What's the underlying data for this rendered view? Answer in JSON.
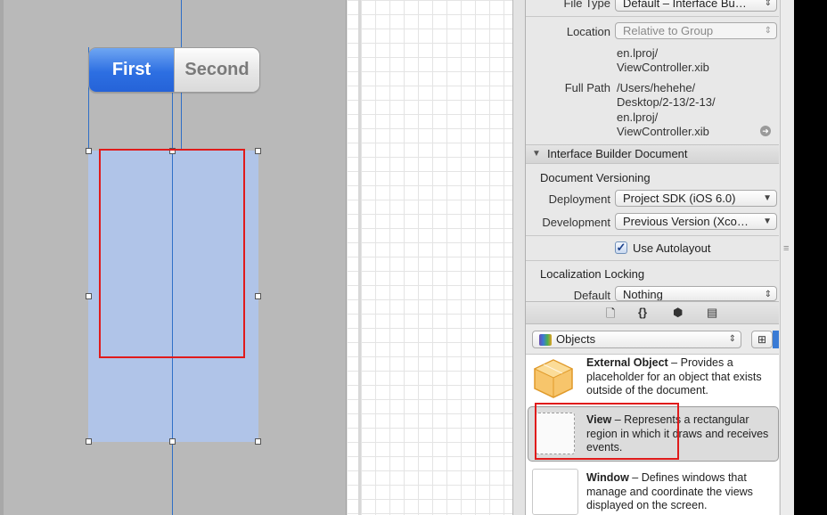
{
  "canvas": {
    "segmented_control": {
      "first": "First",
      "second": "Second"
    }
  },
  "inspector": {
    "file_type": {
      "label": "File Type",
      "value": "Default – Interface Bu…"
    },
    "location": {
      "label": "Location",
      "value": "Relative to Group"
    },
    "location_path": [
      "en.lproj/",
      "ViewController.xib"
    ],
    "full_path": {
      "label": "Full Path",
      "lines": [
        "/Users/hehehe/",
        "Desktop/2-13/2-13/",
        "en.lproj/",
        "ViewController.xib"
      ]
    },
    "ib_section": "Interface Builder Document",
    "versioning": {
      "title": "Document Versioning",
      "deployment_label": "Deployment",
      "deployment_value": "Project SDK (iOS 6.0)",
      "development_label": "Development",
      "development_value": "Previous Version (Xco…"
    },
    "autolayout": {
      "label": "Use Autolayout",
      "checked": true
    },
    "localization": {
      "title": "Localization Locking",
      "default_label": "Default",
      "default_value": "Nothing"
    }
  },
  "tabbar": {
    "icons": [
      "file-template-icon",
      "code-snippet-icon",
      "object-library-icon",
      "media-library-icon"
    ]
  },
  "library": {
    "selector": "Objects",
    "items": [
      {
        "name": "External Object",
        "desc": " – Provides a placeholder for an object that exists outside of the document."
      },
      {
        "name": "View",
        "desc": " – Represents a rectangular region in which it draws and receives events."
      },
      {
        "name": "Window",
        "desc": " – Defines windows that manage and coordinate the views displayed on the screen."
      }
    ]
  },
  "colors": {
    "accent": "#2d6fe2",
    "highlight": "#e01b1b",
    "guide": "#2f6fc7"
  }
}
